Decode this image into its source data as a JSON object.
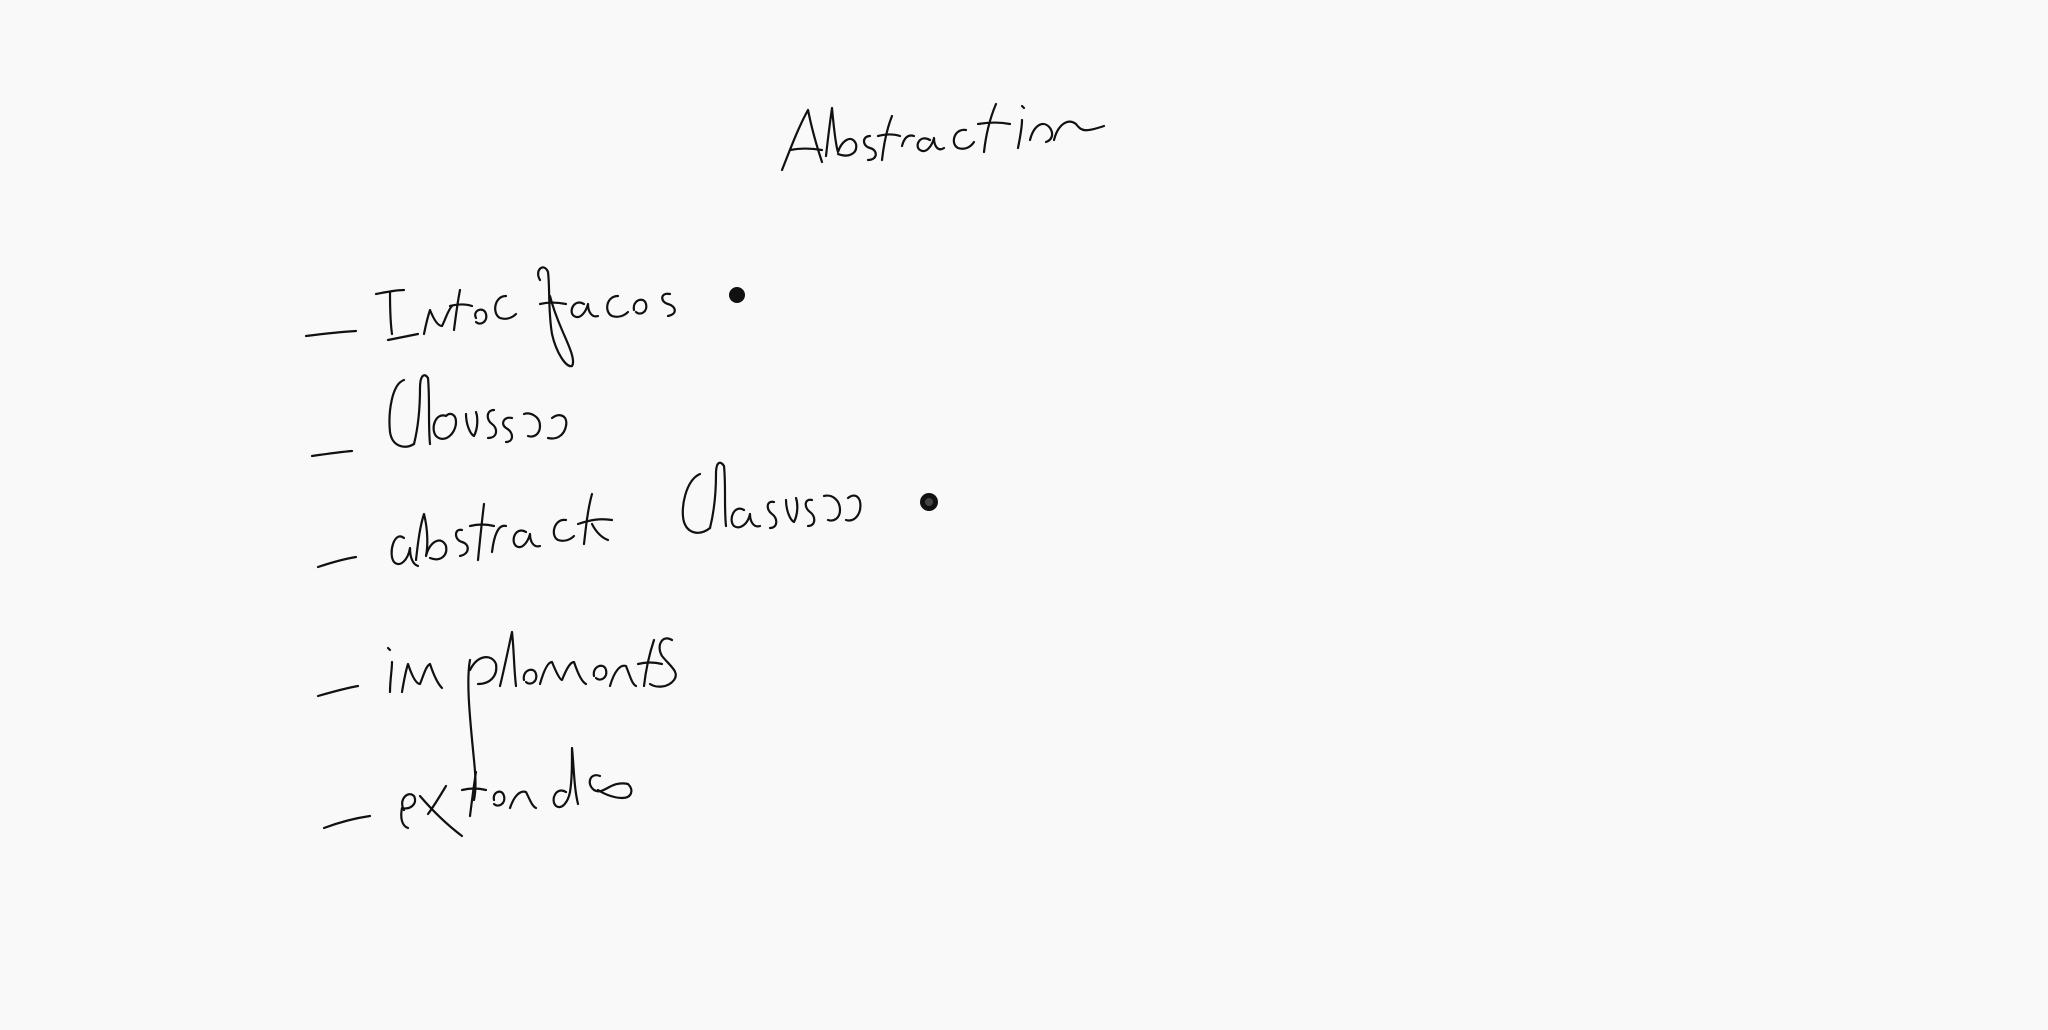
{
  "whiteboard": {
    "background": "#f9f9f9",
    "ink_color": "#111111",
    "title": "Abstraction",
    "items": [
      {
        "label": "Interfaces",
        "marked": true
      },
      {
        "label": "classes",
        "marked": false
      },
      {
        "label": "abstract classes",
        "marked": true
      },
      {
        "label": "implements",
        "marked": false
      },
      {
        "label": "extends",
        "marked": false
      }
    ]
  }
}
